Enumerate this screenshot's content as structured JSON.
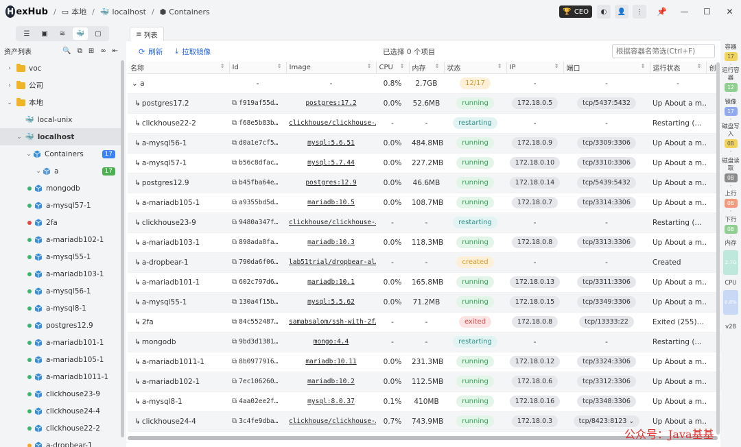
{
  "app": {
    "logo_mark": "H",
    "logo_text": "exHub"
  },
  "breadcrumb": [
    "本地",
    "localhost",
    "Containers"
  ],
  "titlebar": {
    "user_label": "CEO"
  },
  "sidebar": {
    "title": "资产列表",
    "tree": [
      {
        "label": "voc",
        "kind": "folder",
        "level": 0,
        "expanded": false
      },
      {
        "label": "公司",
        "kind": "folder",
        "level": 0,
        "expanded": false
      },
      {
        "label": "本地",
        "kind": "folder",
        "level": 0,
        "expanded": true
      },
      {
        "label": "local-unix",
        "kind": "docker",
        "level": 1
      },
      {
        "label": "localhost",
        "kind": "docker",
        "level": 1,
        "expanded": true,
        "selected": true
      },
      {
        "label": "Containers",
        "kind": "cube",
        "level": 2,
        "expanded": true,
        "count": "17",
        "count_color": "blue"
      },
      {
        "label": "a",
        "kind": "group",
        "level": 3,
        "expanded": true,
        "count": "17",
        "count_color": "green"
      },
      {
        "label": "mongodb",
        "kind": "container",
        "level": 4,
        "status": "g"
      },
      {
        "label": "a-mysql57-1",
        "kind": "container",
        "level": 4,
        "status": "g"
      },
      {
        "label": "2fa",
        "kind": "container",
        "level": 4,
        "status": "r"
      },
      {
        "label": "a-mariadb102-1",
        "kind": "container",
        "level": 4,
        "status": "g"
      },
      {
        "label": "a-mysql55-1",
        "kind": "container",
        "level": 4,
        "status": "g"
      },
      {
        "label": "a-mariadb103-1",
        "kind": "container",
        "level": 4,
        "status": "g"
      },
      {
        "label": "a-mysql56-1",
        "kind": "container",
        "level": 4,
        "status": "g"
      },
      {
        "label": "a-mysql8-1",
        "kind": "container",
        "level": 4,
        "status": "g"
      },
      {
        "label": "postgres12.9",
        "kind": "container",
        "level": 4,
        "status": "g"
      },
      {
        "label": "a-mariadb101-1",
        "kind": "container",
        "level": 4,
        "status": "g"
      },
      {
        "label": "a-mariadb105-1",
        "kind": "container",
        "level": 4,
        "status": "g"
      },
      {
        "label": "a-mariadb1011-1",
        "kind": "container",
        "level": 4,
        "status": "g"
      },
      {
        "label": "clickhouse23-9",
        "kind": "container",
        "level": 4,
        "status": "g"
      },
      {
        "label": "clickhouse24-4",
        "kind": "container",
        "level": 4,
        "status": "g"
      },
      {
        "label": "clickhouse22-2",
        "kind": "container",
        "level": 4,
        "status": "g"
      },
      {
        "label": "a-dropbear-1",
        "kind": "container",
        "level": 4,
        "status": "o"
      }
    ]
  },
  "tab": {
    "label": "列表"
  },
  "actions": {
    "refresh": "刷新",
    "pull": "拉取镜像"
  },
  "selection": {
    "text": "已选择 0 个项目"
  },
  "filter": {
    "placeholder": "根据容器名筛选(Ctrl+F)"
  },
  "columns": [
    "名称",
    "Id",
    "Image",
    "CPU",
    "内存",
    "状态",
    "IP",
    "端口",
    "运行状态",
    "创"
  ],
  "group_row": {
    "name": "a",
    "id": "-",
    "image": "-",
    "cpu": "0.8%",
    "mem": "2.7GB",
    "status": "12/17",
    "ip": "-",
    "port": "-",
    "runstate": "-"
  },
  "rows": [
    {
      "name": "postgres17.2",
      "id": "f919af55d…",
      "image": "postgres:17.2",
      "cpu": "0.0%",
      "mem": "52.6MB",
      "status": "running",
      "ip": "172.18.0.5",
      "port": "tcp/5437:5432",
      "runstate": "Up About a m…"
    },
    {
      "name": "clickhouse22-2",
      "id": "f68e5b83b…",
      "image": "clickhouse/clickhouse-…",
      "cpu": "-",
      "mem": "-",
      "status": "restarting",
      "ip": "-",
      "port": "-",
      "runstate": "Restarting (…"
    },
    {
      "name": "a-mysql56-1",
      "id": "d0a1e7cf5…",
      "image": "mysql:5.6.51",
      "cpu": "0.0%",
      "mem": "484.8MB",
      "status": "running",
      "ip": "172.18.0.9",
      "port": "tcp/3309:3306",
      "runstate": "Up About a m…"
    },
    {
      "name": "a-mysql57-1",
      "id": "b56c8dfac…",
      "image": "mysql:5.7.44",
      "cpu": "0.0%",
      "mem": "227.2MB",
      "status": "running",
      "ip": "172.18.0.10",
      "port": "tcp/3310:3306",
      "runstate": "Up About a m…"
    },
    {
      "name": "postgres12.9",
      "id": "b45fba64e…",
      "image": "postgres:12.9",
      "cpu": "0.0%",
      "mem": "46.6MB",
      "status": "running",
      "ip": "172.18.0.14",
      "port": "tcp/5439:5432",
      "runstate": "Up About a m…"
    },
    {
      "name": "a-mariadb105-1",
      "id": "a9355bd5d…",
      "image": "mariadb:10.5",
      "cpu": "0.0%",
      "mem": "108.7MB",
      "status": "running",
      "ip": "172.18.0.7",
      "port": "tcp/3314:3306",
      "runstate": "Up About a m…"
    },
    {
      "name": "clickhouse23-9",
      "id": "9480a347f…",
      "image": "clickhouse/clickhouse-…",
      "cpu": "-",
      "mem": "-",
      "status": "restarting",
      "ip": "-",
      "port": "-",
      "runstate": "Restarting (…"
    },
    {
      "name": "a-mariadb103-1",
      "id": "898ada8fa…",
      "image": "mariadb:10.3",
      "cpu": "0.0%",
      "mem": "118.3MB",
      "status": "running",
      "ip": "172.18.0.8",
      "port": "tcp/3313:3306",
      "runstate": "Up About a m…"
    },
    {
      "name": "a-dropbear-1",
      "id": "790da6f06…",
      "image": "lab51trial/dropbear-al…",
      "cpu": "-",
      "mem": "-",
      "status": "created",
      "ip": "-",
      "port": "-",
      "runstate": "Created"
    },
    {
      "name": "a-mariadb101-1",
      "id": "602c797d6…",
      "image": "mariadb:10.1",
      "cpu": "0.0%",
      "mem": "165.8MB",
      "status": "running",
      "ip": "172.18.0.13",
      "port": "tcp/3311:3306",
      "runstate": "Up About a m…"
    },
    {
      "name": "a-mysql55-1",
      "id": "130a4f15b…",
      "image": "mysql:5.5.62",
      "cpu": "0.0%",
      "mem": "71.2MB",
      "status": "running",
      "ip": "172.18.0.15",
      "port": "tcp/3349:3306",
      "runstate": "Up About a m…"
    },
    {
      "name": "2fa",
      "id": "84c552487…",
      "image": "samabsalom/ssh-with-2f…",
      "cpu": "-",
      "mem": "-",
      "status": "exited",
      "ip": "172.18.0.8",
      "port": "tcp/13333:22",
      "runstate": "Exited (255)…"
    },
    {
      "name": "mongodb",
      "id": "9bd3d1381…",
      "image": "mongo:4.4",
      "cpu": "-",
      "mem": "-",
      "status": "restarting",
      "ip": "-",
      "port": "-",
      "runstate": "Restarting (…"
    },
    {
      "name": "a-mariadb1011-1",
      "id": "8b0977916…",
      "image": "mariadb:10.11",
      "cpu": "0.0%",
      "mem": "231.3MB",
      "status": "running",
      "ip": "172.18.0.12",
      "port": "tcp/3324:3306",
      "runstate": "Up About a m…"
    },
    {
      "name": "a-mariadb102-1",
      "id": "7ec106260…",
      "image": "mariadb:10.2",
      "cpu": "0.0%",
      "mem": "112.5MB",
      "status": "running",
      "ip": "172.18.0.6",
      "port": "tcp/3312:3306",
      "runstate": "Up About a m…"
    },
    {
      "name": "a-mysql8-1",
      "id": "4aa02ee2f…",
      "image": "mysql:8.0.37",
      "cpu": "0.1%",
      "mem": "410MB",
      "status": "running",
      "ip": "172.18.0.16",
      "port": "tcp/3348:3306",
      "runstate": "Up About a m…"
    },
    {
      "name": "clickhouse24-4",
      "id": "3c4fe9dba…",
      "image": "clickhouse/clickhouse-…",
      "cpu": "0.7%",
      "mem": "743.9MB",
      "status": "running",
      "ip": "172.18.0.3",
      "port": "tcp/8423:8123",
      "runstate": "Up About a m…",
      "port_has_dropdown": true
    }
  ],
  "right_panel": [
    {
      "label": "容器",
      "value": "17",
      "color": "#f2d35b",
      "text": "#555"
    },
    {
      "label": "运行容器",
      "value": "12",
      "color": "#8fcf8f",
      "text": "#fff"
    },
    {
      "label": "镜像",
      "value": "17",
      "color": "#8fa8f0",
      "text": "#fff"
    },
    {
      "label": "磁盘写入",
      "value": "0B",
      "color": "#f2d35b",
      "text": "#555"
    },
    {
      "label": "磁盘读取",
      "value": "0B",
      "color": "#8a8a8a",
      "text": "#fff"
    },
    {
      "label": "上行",
      "value": "0B",
      "color": "#f29a7b",
      "text": "#fff"
    },
    {
      "label": "下行",
      "value": "0B",
      "color": "#8fcf8f",
      "text": "#fff"
    },
    {
      "label": "内存",
      "value": "2.7G",
      "color": "#bfe8dd",
      "text": "#fff"
    },
    {
      "label": "CPU",
      "value": "0.8%",
      "color": "#c9d9f5",
      "text": "#fff"
    }
  ],
  "version": "v28",
  "watermark": "公众号：Java基基"
}
